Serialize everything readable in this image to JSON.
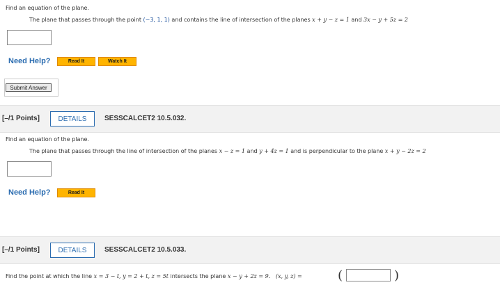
{
  "q1": {
    "instruction": "Find an equation of the plane.",
    "prompt_prefix": "The plane that passes through the point ",
    "point": "(−3, 1, 1)",
    "prompt_mid": " and contains the line of intersection of the planes ",
    "plane1": "x + y − z = 1",
    "and": " and ",
    "plane2": "3x − y + 5z = 2",
    "answer": "",
    "need_help": "Need Help?",
    "read_it": "Read It",
    "watch_it": "Watch It",
    "submit": "Submit Answer"
  },
  "q2": {
    "points": "[–/1 Points]",
    "details": "DETAILS",
    "id": "SESSCALCET2 10.5.032.",
    "instruction": "Find an equation of the plane.",
    "prompt_prefix": "The plane that passes through the line of intersection of the planes ",
    "plane1": "x − z = 1",
    "and": " and ",
    "plane2": "y + 4z = 1",
    "prompt_mid": " and is perpendicular to the plane ",
    "plane3": "x + y − 2z = 2",
    "answer": "",
    "need_help": "Need Help?",
    "read_it": "Read It"
  },
  "q3": {
    "points": "[–/1 Points]",
    "details": "DETAILS",
    "id": "SESSCALCET2 10.5.033.",
    "prompt_prefix": "Find the point at which the line ",
    "line": "x = 3 − t, y = 2 + t, z = 5t",
    "prompt_mid": " intersects the plane ",
    "plane": "x − y + 2z = 9.",
    "tuple_label": "(x, y, z) =",
    "answer": ""
  }
}
